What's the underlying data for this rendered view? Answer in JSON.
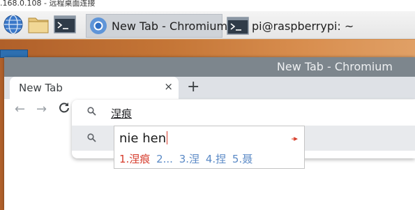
{
  "remote_title": ".168.0.108 - 远程桌面连接",
  "taskbar": {
    "launchers": [
      {
        "icon": "globe-icon"
      },
      {
        "icon": "folder-icon"
      },
      {
        "icon": "terminal-icon"
      }
    ],
    "tasks": [
      {
        "label": "New Tab - Chromium",
        "icon": "chromium-icon",
        "active": true
      },
      {
        "label": "pi@raspberrypi: ~",
        "icon": "terminal-icon",
        "active": false
      }
    ]
  },
  "chromium": {
    "window_title": "New Tab - Chromium",
    "tab_label": "New Tab",
    "tab_close": "×",
    "new_tab": "+",
    "back": "←",
    "forward": "→",
    "reload": "C"
  },
  "omnibox": {
    "text": "涅痕"
  },
  "ime": {
    "input": "nie hen",
    "arrow_left": "◂",
    "arrow_right": "▸",
    "candidates": [
      "1.涅痕",
      "2...",
      "3.涅",
      "4.捏",
      "5.聂"
    ]
  },
  "colors": {
    "desktop": "#c47536",
    "title_bar": "#7d868d",
    "accent_red": "#d63b2b",
    "candidate_blue": "#5b8ac6"
  }
}
